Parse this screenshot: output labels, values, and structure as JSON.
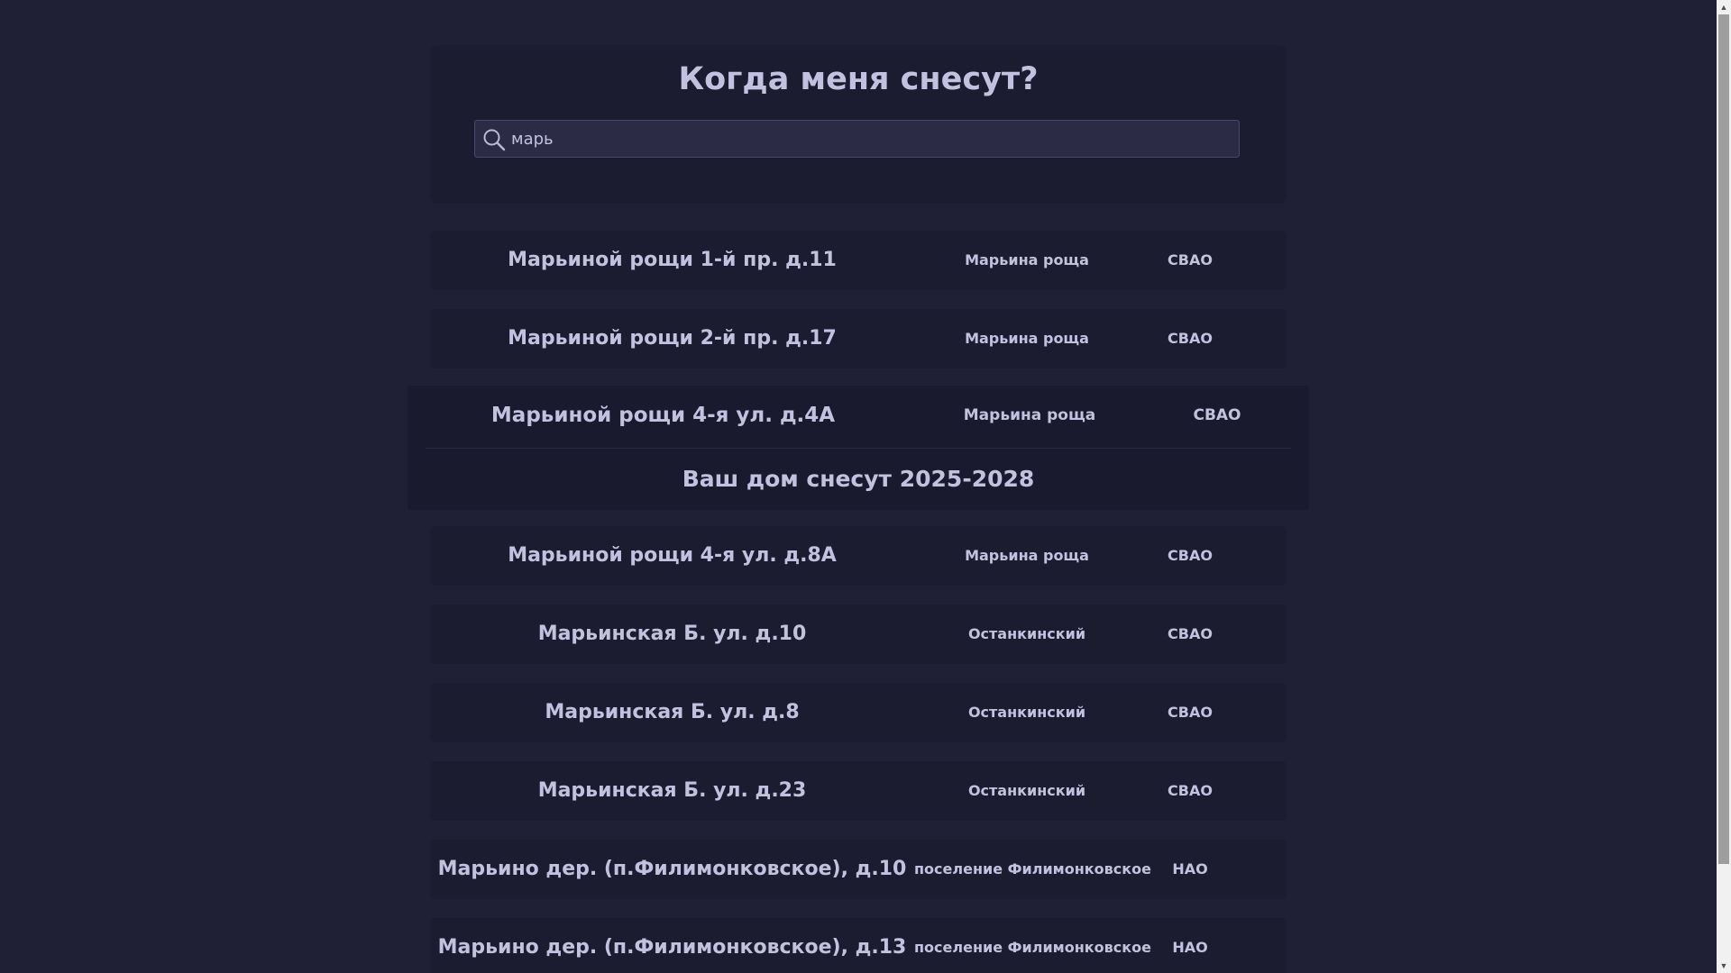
{
  "header": {
    "title": "Когда меня снесут?"
  },
  "search": {
    "value": "марь",
    "icon": "search-icon"
  },
  "results": [
    {
      "address": "Марьиной рощи 1-й пр. д.11",
      "district": "Марьина роща",
      "okrug": "СВАО"
    },
    {
      "address": "Марьиной рощи 2-й пр. д.17",
      "district": "Марьина роща",
      "okrug": "СВАО"
    },
    {
      "address": "Марьиной рощи 4-я ул. д.4А",
      "district": "Марьина роща",
      "okrug": "СВАО",
      "expanded": true,
      "details": "Ваш дом снесут 2025-2028"
    },
    {
      "address": "Марьиной рощи 4-я ул. д.8А",
      "district": "Марьина роща",
      "okrug": "СВАО"
    },
    {
      "address": "Марьинская Б. ул. д.10",
      "district": "Останкинский",
      "okrug": "СВАО"
    },
    {
      "address": "Марьинская Б. ул. д.8",
      "district": "Останкинский",
      "okrug": "СВАО"
    },
    {
      "address": "Марьинская Б. ул. д.23",
      "district": "Останкинский",
      "okrug": "СВАО"
    },
    {
      "address": "Марьино дер. (п.Филимонковское), д.10",
      "district": "поселение Филимонковское",
      "okrug": "НАО"
    },
    {
      "address": "Марьино дер. (п.Филимонковское), д.13",
      "district": "поселение Филимонковское",
      "okrug": "НАО"
    }
  ],
  "scrollbar": {
    "up_icon": "▲",
    "down_icon": "▼"
  },
  "colors": {
    "background": "#1f1f35",
    "card": "#1c1c31",
    "text": "#c2c2e0",
    "input_bg": "#2b2b45"
  }
}
